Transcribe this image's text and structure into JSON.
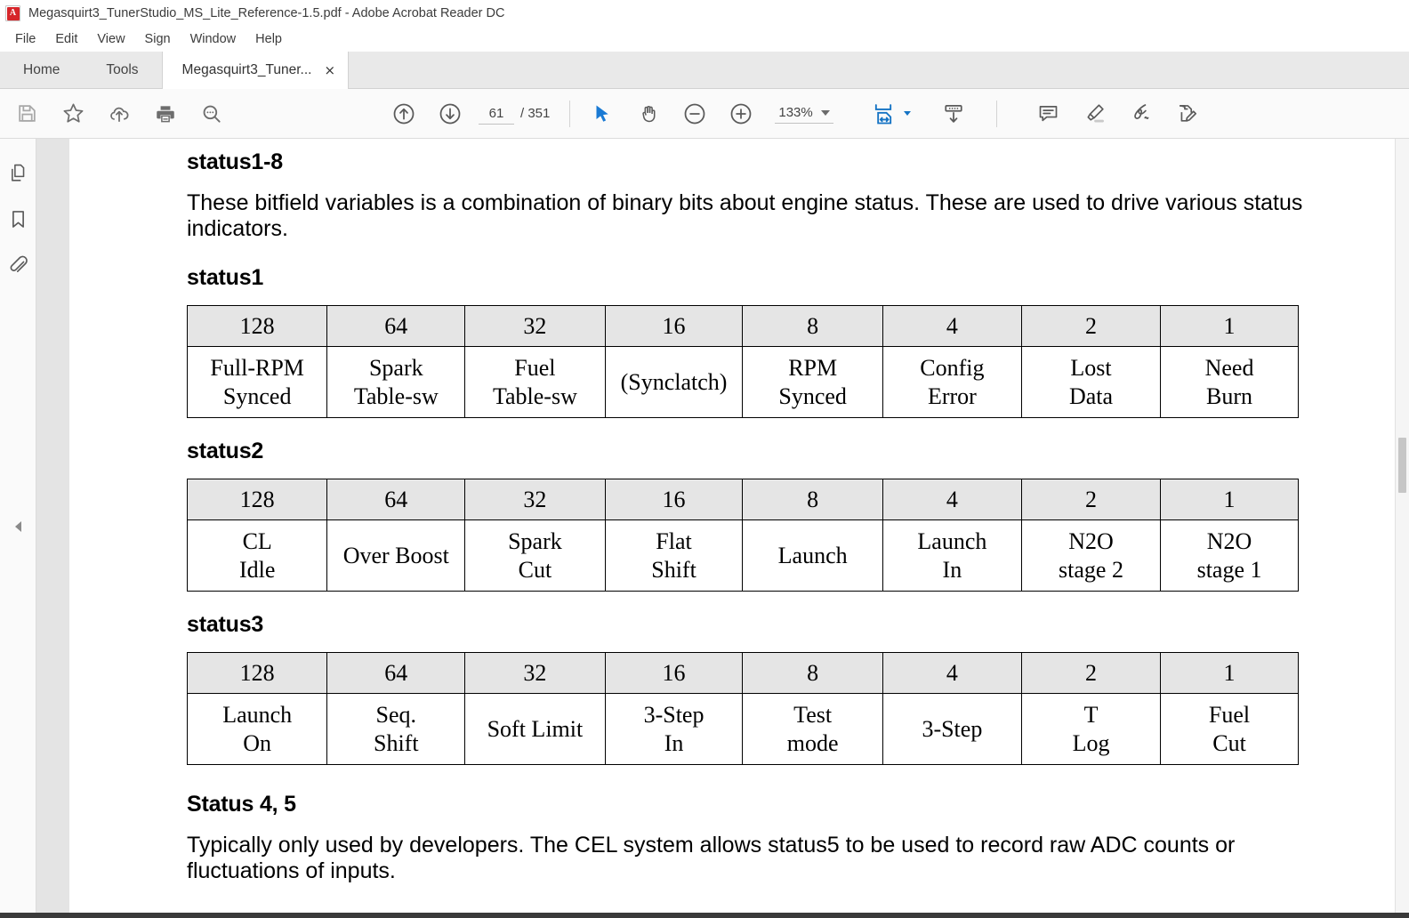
{
  "window": {
    "title": "Megasquirt3_TunerStudio_MS_Lite_Reference-1.5.pdf - Adobe Acrobat Reader DC",
    "app_icon": "pdf-document-icon"
  },
  "menubar": {
    "items": [
      {
        "label": "File"
      },
      {
        "label": "Edit"
      },
      {
        "label": "View"
      },
      {
        "label": "Sign"
      },
      {
        "label": "Window"
      },
      {
        "label": "Help"
      }
    ]
  },
  "tabs": {
    "home_label": "Home",
    "tools_label": "Tools",
    "document_label": "Megasquirt3_Tuner...",
    "close_glyph": "×"
  },
  "toolbar": {
    "left_icons": [
      {
        "name": "save-icon",
        "title": "Save"
      },
      {
        "name": "star-icon",
        "title": "Add to favorites"
      },
      {
        "name": "cloud-upload-icon",
        "title": "Upload"
      },
      {
        "name": "print-icon",
        "title": "Print"
      },
      {
        "name": "search-icon",
        "title": "Find"
      }
    ],
    "page_up_icon": "arrow-up-circle-icon",
    "page_down_icon": "arrow-down-circle-icon",
    "page_current": "61",
    "page_total": "/ 351",
    "select_tool_icon": "cursor-arrow-icon",
    "hand_tool_icon": "hand-icon",
    "zoom_out_icon": "minus-circle-icon",
    "zoom_in_icon": "plus-circle-icon",
    "zoom_value": "133%",
    "fit_page_icon": "fit-page-icon",
    "scroll_mode_icon": "page-scroll-icon",
    "right_icons": [
      {
        "name": "comment-icon",
        "title": "Add comment"
      },
      {
        "name": "highlight-icon",
        "title": "Highlight text"
      },
      {
        "name": "sign-icon",
        "title": "Sign"
      },
      {
        "name": "fill-and-sign-icon",
        "title": "Fill & Sign"
      }
    ],
    "accent_color": "#1473c4"
  },
  "navpane": {
    "items": [
      {
        "name": "page-thumbnails-icon",
        "title": "Page Thumbnails"
      },
      {
        "name": "bookmarks-icon",
        "title": "Bookmarks"
      },
      {
        "name": "attachments-icon",
        "title": "Attachments"
      }
    ],
    "collapse_icon": "chevron-left-icon"
  },
  "document": {
    "clipped_top_text": "status indicators.",
    "heading_1": "status1-8",
    "paragraph_1": "These bitfield variables is a combination of binary bits about engine status. These are used to drive various status indicators.",
    "heading_status1": "status1",
    "heading_status2": "status2",
    "heading_status3": "status3",
    "heading_status45": "Status 4, 5",
    "paragraph_2": "Typically only used by developers. The CEL system allows status5 to be used to record raw ADC counts or fluctuations of inputs.",
    "tables": {
      "status1": {
        "bits": [
          "128",
          "64",
          "32",
          "16",
          "8",
          "4",
          "2",
          "1"
        ],
        "labels": [
          "Full-RPM\nSynced",
          "Spark\nTable-sw",
          "Fuel\nTable-sw",
          "(Synclatch)",
          "RPM\nSynced",
          "Config\nError",
          "Lost\nData",
          "Need\nBurn"
        ]
      },
      "status2": {
        "bits": [
          "128",
          "64",
          "32",
          "16",
          "8",
          "4",
          "2",
          "1"
        ],
        "labels": [
          "CL\nIdle",
          "Over Boost",
          "Spark\nCut",
          "Flat\nShift",
          "Launch",
          "Launch\nIn",
          "N2O\nstage 2",
          "N2O\nstage 1"
        ]
      },
      "status3": {
        "bits": [
          "128",
          "64",
          "32",
          "16",
          "8",
          "4",
          "2",
          "1"
        ],
        "labels": [
          "Launch\nOn",
          "Seq.\nShift",
          "Soft Limit",
          "3-Step\nIn",
          "Test\nmode",
          "3-Step",
          "T\nLog",
          "Fuel\nCut"
        ]
      }
    }
  }
}
